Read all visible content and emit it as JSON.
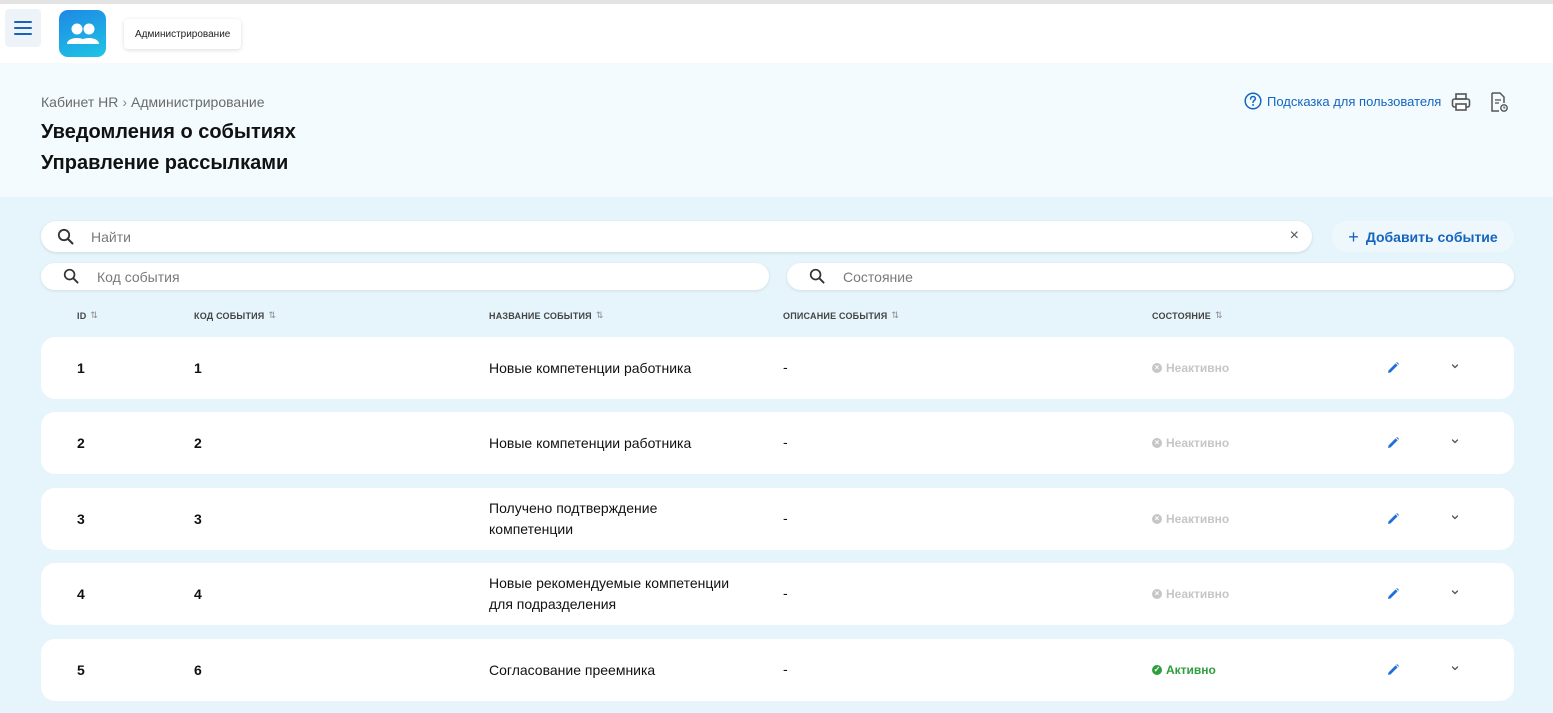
{
  "topbar": {
    "app_chip_label": "Администрирование"
  },
  "header": {
    "breadcrumb": [
      "Кабинет HR",
      "Администрирование"
    ],
    "breadcrumb_separator": "›",
    "title_line1": "Уведомления о событиях",
    "title_line2": "Управление рассылками",
    "help_label": "Подсказка для пользователя"
  },
  "search": {
    "placeholder": "Найти",
    "clear_symbol": "×"
  },
  "add_button": {
    "icon": "+",
    "label": "Добавить событие"
  },
  "filters": {
    "code_placeholder": "Код события",
    "state_placeholder": "Состояние"
  },
  "columns": {
    "id": "ID",
    "code": "КОД СОБЫТИЯ",
    "name": "НАЗВАНИЕ СОБЫТИЯ",
    "description": "ОПИСАНИЕ СОБЫТИЯ",
    "state": "СОСТОЯНИЕ",
    "sort_symbol": "⇅"
  },
  "rows": [
    {
      "id": "1",
      "code": "1",
      "name_lines": [
        "Новые компетенции работника"
      ],
      "description": "-",
      "status": "Неактивно",
      "active": false
    },
    {
      "id": "2",
      "code": "2",
      "name_lines": [
        "Новые компетенции работника"
      ],
      "description": "-",
      "status": "Неактивно",
      "active": false
    },
    {
      "id": "3",
      "code": "3",
      "name_lines": [
        "Получено подтверждение",
        "компетенции"
      ],
      "description": "-",
      "status": "Неактивно",
      "active": false
    },
    {
      "id": "4",
      "code": "4",
      "name_lines": [
        "Новые рекомендуемые компетенции",
        "для подразделения"
      ],
      "description": "-",
      "status": "Неактивно",
      "active": false
    },
    {
      "id": "5",
      "code": "6",
      "name_lines": [
        "Согласование преемника"
      ],
      "description": "-",
      "status": "Активно",
      "active": true
    }
  ],
  "colors": {
    "accent": "#1565c0",
    "active_status": "#2e9e3e",
    "inactive_status": "#c6c6c6",
    "page_background": "#e6f5fc"
  }
}
